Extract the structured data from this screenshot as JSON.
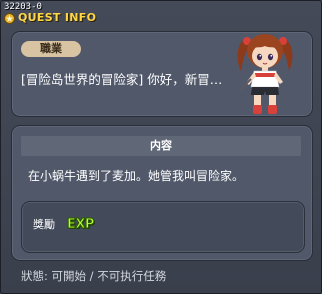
{
  "window": {
    "quest_id": "32203-0",
    "title": "QUEST INFO"
  },
  "intro": {
    "job_label": "職業",
    "text": "[冒险岛世界的冒险家] 你好，新冒…"
  },
  "content": {
    "header": "内容",
    "text": "在小蜗牛遇到了麦加。她管我叫冒险家。"
  },
  "reward": {
    "label": "獎勵",
    "exp_label": "EXP"
  },
  "status": {
    "text": "狀態: 可開始 / 不可执行任務"
  },
  "colors": {
    "title": "#ffd64a",
    "job_tag_bg": "#d8c3a2",
    "exp": "#b8ff3a"
  }
}
